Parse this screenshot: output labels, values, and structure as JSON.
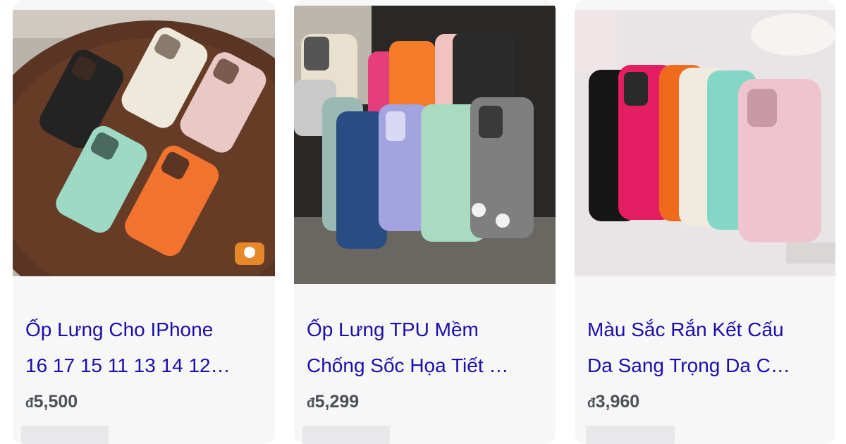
{
  "products": [
    {
      "title_line1": "Ốp Lưng Cho IPhone",
      "title_line2": "16 17 15 11 13 14 12…",
      "currency": "đ",
      "price": "5,500",
      "image_icon": "phone-cases-on-wood-table"
    },
    {
      "title_line1": "Ốp Lưng TPU Mềm",
      "title_line2": "Chống Sốc Họa Tiết …",
      "currency": "đ",
      "price": "5,299",
      "image_icon": "phone-cases-on-fabric"
    },
    {
      "title_line1": "Màu Sắc Rắn Kết Cấu",
      "title_line2": "Da Sang Trọng Da C…",
      "currency": "đ",
      "price": "3,960",
      "image_icon": "phone-cases-fanned-row"
    }
  ],
  "colors": {
    "title_link": "#1a0dab",
    "price": "#4d5156",
    "card_bg": "#f7f7f8",
    "skeleton": "#e8e8ea"
  }
}
